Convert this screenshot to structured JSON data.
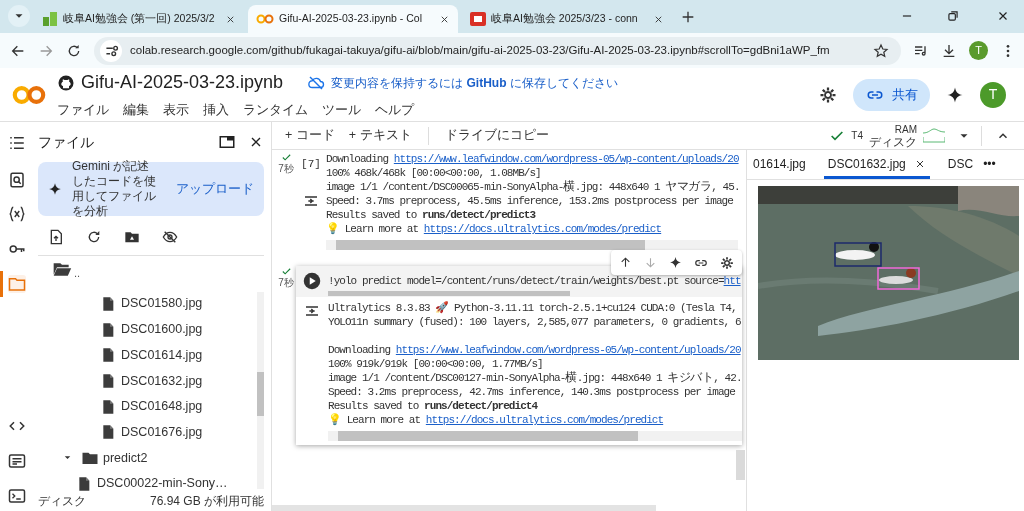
{
  "browser": {
    "tabs": [
      {
        "title": "岐阜AI勉強会 (第一回) 2025/3/2",
        "selected": false,
        "kind": "blocks"
      },
      {
        "title": "Gifu-AI-2025-03-23.ipynb - Col",
        "selected": true,
        "kind": "colab"
      },
      {
        "title": "岐阜AI勉強会 2025/3/23 - conn",
        "selected": false,
        "kind": "slides"
      }
    ],
    "url": "colab.research.google.com/github/fukagai-takuya/gifu-ai/blob/main/gifu-ai-2025-03-23/Gifu-AI-2025-03-23.ipynb#scrollTo=gdBni1aWP_fm",
    "profile": "T"
  },
  "header": {
    "title": "Gifu-AI-2025-03-23.ipynb",
    "notice": "変更内容を保持するには **GitHub** に保存してください",
    "menu": [
      "ファイル",
      "編集",
      "表示",
      "挿入",
      "ランタイム",
      "ツール",
      "ヘルプ"
    ],
    "share": "共有",
    "avatar": "T"
  },
  "sidebar": {
    "items": [
      {
        "kind": "toc",
        "selected": false
      },
      {
        "kind": "search",
        "selected": false
      },
      {
        "kind": "variables",
        "selected": false
      },
      {
        "kind": "secrets",
        "selected": false
      },
      {
        "kind": "files",
        "selected": true
      },
      {
        "kind": "code",
        "selected": false
      },
      {
        "kind": "commands",
        "selected": false
      },
      {
        "kind": "terminal",
        "selected": false
      }
    ]
  },
  "files": {
    "title": "ファイル",
    "banner": "Gemini が記述したコードを使用してファイルを分析",
    "banner_link": "アップロード",
    "tree": [
      {
        "kind": "parent",
        "label": ".."
      },
      {
        "kind": "scrolled_folder",
        "children": [
          {
            "kind": "file",
            "label": "DSC01580.jpg"
          },
          {
            "kind": "file",
            "label": "DSC01600.jpg"
          },
          {
            "kind": "file",
            "label": "DSC01614.jpg"
          },
          {
            "kind": "file",
            "label": "DSC01632.jpg"
          },
          {
            "kind": "file",
            "label": "DSC01648.jpg"
          },
          {
            "kind": "file",
            "label": "DSC01676.jpg"
          }
        ]
      },
      {
        "kind": "folder",
        "label": "predict2",
        "expanded": true,
        "children": [
          {
            "kind": "file",
            "label": "DSC00022-min-Sony…"
          }
        ]
      }
    ],
    "disk_label": "ディスク",
    "disk_free": "76.94 GB が利用可能"
  },
  "toolbar": {
    "add_code": "+ コード",
    "add_text": "+ テキスト",
    "copy": "ドライブにコピー",
    "connected": true,
    "runtime": "T4",
    "ram": "RAM",
    "disk": "ディスク"
  },
  "cells": [
    {
      "kind": "output_only",
      "done": true,
      "time": "7秒",
      "count": "[7]",
      "selected": false,
      "lines": [
        [
          {
            "kind": "text",
            "text": "Downloading "
          },
          {
            "kind": "link",
            "text": "https://www.leafwindow.com/wordpress-05/wp-content/uploads/20"
          }
        ],
        [
          {
            "kind": "text",
            "text": "100% 468k/468k [00:00<00:00, 1.08MB/s]"
          }
        ],
        [
          {
            "kind": "text",
            "text": "image 1/1 /content/DSC00065-min-SonyAlpha-横.jpg: 448x640 1 ヤマガラ, 45."
          }
        ],
        [
          {
            "kind": "text",
            "text": "Speed: 3.7ms preprocess, 45.5ms inference, 153.2ms postprocess per image"
          }
        ],
        [
          {
            "kind": "text",
            "text": "Results saved to "
          },
          {
            "kind": "bold",
            "text": "runs/detect/predict3"
          }
        ],
        [
          {
            "kind": "text",
            "text": "💡 Learn more at "
          },
          {
            "kind": "link",
            "text": "https://docs.ultralytics.com/modes/predict"
          }
        ]
      ]
    },
    {
      "kind": "code",
      "done": true,
      "time": "7秒",
      "selected": true,
      "code": [
        {
          "kind": "text",
          "text": "!yolo predict model=/content/runs/detect/train/weights/best.pt source="
        },
        {
          "kind": "link",
          "text": "htt"
        }
      ],
      "lines": [
        [
          {
            "kind": "text",
            "text": "Ultralytics 8.3.83 🚀 Python-3.11.11 torch-2.5.1+cu124 CUDA:0 (Tesla T4,"
          }
        ],
        [
          {
            "kind": "text",
            "text": "YOLO11n summary (fused): 100 layers, 2,585,077 parameters, 0 gradients, 6"
          }
        ],
        [
          {
            "kind": "gap"
          },
          {
            "kind": "text",
            "text": "Downloading "
          },
          {
            "kind": "link",
            "text": "https://www.leafwindow.com/wordpress-05/wp-content/uploads/20"
          }
        ],
        [
          {
            "kind": "text",
            "text": "100% 919k/919k [00:00<00:00, 1.77MB/s]"
          }
        ],
        [
          {
            "kind": "text",
            "text": "image 1/1 /content/DSC00127-min-SonyAlpha-横.jpg: 448x640 1 キジバト, 42."
          }
        ],
        [
          {
            "kind": "text",
            "text": "Speed: 3.2ms preprocess, 42.7ms inference, 140.3ms postprocess per image"
          }
        ],
        [
          {
            "kind": "text",
            "text": "Results saved to "
          },
          {
            "kind": "bold",
            "text": "runs/detect/predict4"
          }
        ],
        [
          {
            "kind": "text",
            "text": "💡 Learn more at "
          },
          {
            "kind": "link",
            "text": "https://docs.ultralytics.com/modes/predict"
          }
        ]
      ]
    }
  ],
  "viewer": {
    "tabs": [
      {
        "label": "01614.jpg",
        "selected": false
      },
      {
        "label": "DSC01632.jpg",
        "selected": true
      },
      {
        "label": "DSC",
        "selected": false
      }
    ],
    "more": "•••"
  }
}
